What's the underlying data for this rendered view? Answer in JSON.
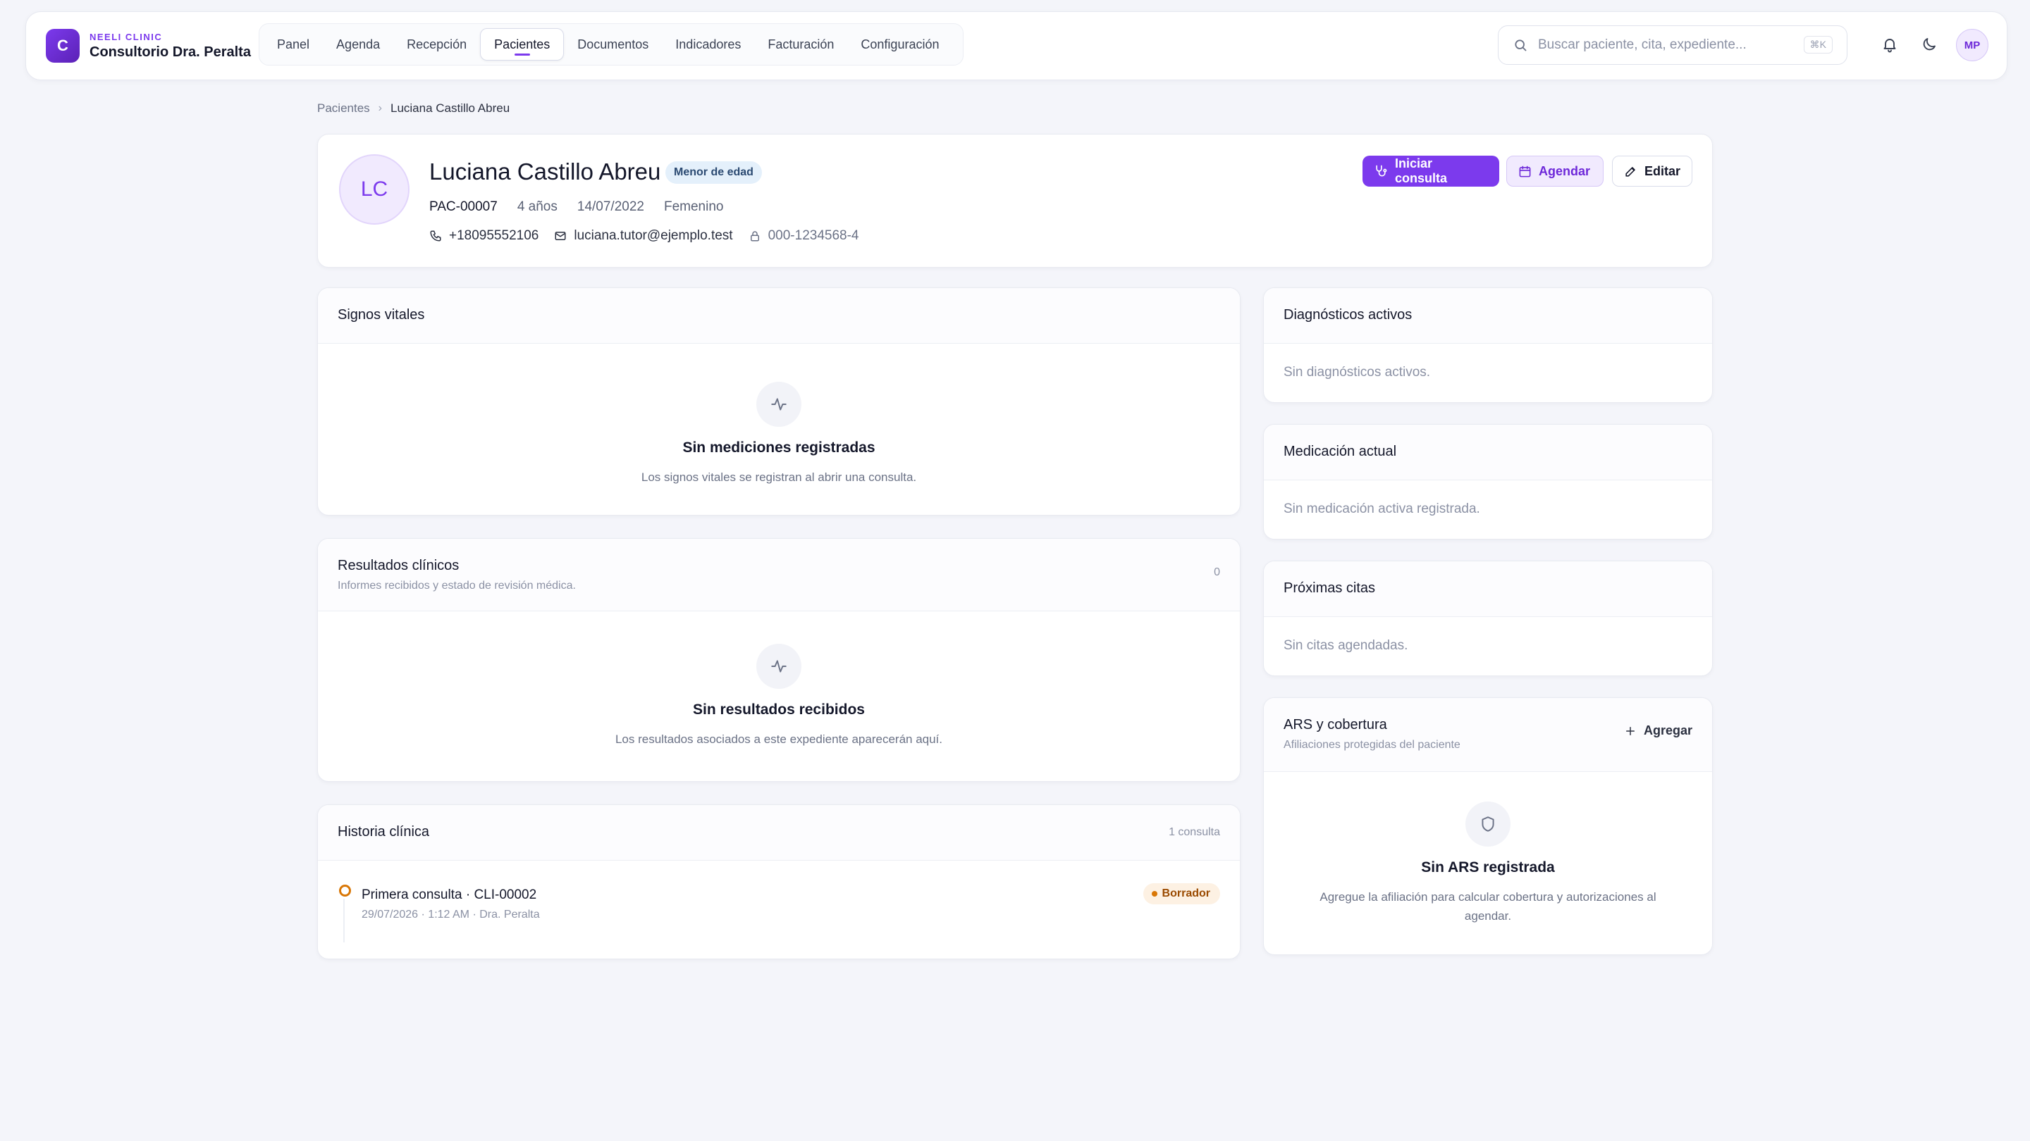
{
  "brand": {
    "logo_letter": "C",
    "small": "NEELI CLINIC",
    "name": "Consultorio Dra. Peralta",
    "accent": "#7c3aed"
  },
  "nav": {
    "items": [
      {
        "label": "Panel",
        "active": false
      },
      {
        "label": "Agenda",
        "active": false
      },
      {
        "label": "Recepción",
        "active": false
      },
      {
        "label": "Pacientes",
        "active": true
      },
      {
        "label": "Documentos",
        "active": false
      },
      {
        "label": "Indicadores",
        "active": false
      },
      {
        "label": "Facturación",
        "active": false
      },
      {
        "label": "Configuración",
        "active": false
      }
    ]
  },
  "search": {
    "placeholder": "Buscar paciente, cita, expediente...",
    "value": "",
    "shortcut": "⌘K",
    "icon": "search-icon"
  },
  "top_icons": [
    "bell-icon",
    "moon-icon"
  ],
  "user": {
    "initials": "MP"
  },
  "breadcrumb": {
    "parent": "Pacientes",
    "current": "Luciana Castillo Abreu"
  },
  "patient": {
    "initials": "LC",
    "name": "Luciana Castillo Abreu",
    "badge": "Menor de edad",
    "code": "PAC-00007",
    "age": "4 años",
    "birthdate": "14/07/2022",
    "sex": "Femenino",
    "phone": "+18095552106",
    "email": "luciana.tutor@ejemplo.test",
    "id_number": "000-1234568-4"
  },
  "actions": {
    "start": "Iniciar consulta",
    "schedule": "Agendar",
    "edit": "Editar"
  },
  "vitals": {
    "title": "Signos vitales",
    "empty_title": "Sin mediciones registradas",
    "empty_desc": "Los signos vitales se registran al abrir una consulta."
  },
  "results": {
    "title": "Resultados clínicos",
    "subtitle": "Informes recibidos y estado de revisión médica.",
    "count": "0",
    "empty_title": "Sin resultados recibidos",
    "empty_desc": "Los resultados asociados a este expediente aparecerán aquí."
  },
  "history": {
    "title": "Historia clínica",
    "count": "1 consulta",
    "entries": [
      {
        "title": "Primera consulta · CLI-00002",
        "meta": "29/07/2026 · 1:12 AM · Dra. Peralta",
        "status": "Borrador",
        "status_color": "#d97706"
      }
    ]
  },
  "diagnoses": {
    "title": "Diagnósticos activos",
    "empty": "Sin diagnósticos activos."
  },
  "medication": {
    "title": "Medicación actual",
    "empty": "Sin medicación activa registrada."
  },
  "appointments": {
    "title": "Próximas citas",
    "empty": "Sin citas agendadas."
  },
  "insurance": {
    "title": "ARS y cobertura",
    "subtitle": "Afiliaciones protegidas del paciente",
    "add": "Agregar",
    "empty_title": "Sin ARS registrada",
    "empty_desc": "Agregue la afiliación para calcular cobertura y autorizaciones al agendar."
  }
}
